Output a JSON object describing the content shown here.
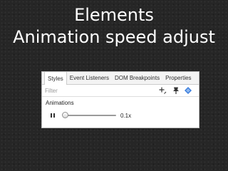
{
  "slide": {
    "title": "Elements",
    "subtitle": "Animation speed adjust"
  },
  "devtools": {
    "tabs": [
      {
        "label": "Styles",
        "active": true
      },
      {
        "label": "Event Listeners",
        "active": false
      },
      {
        "label": "DOM Breakpoints",
        "active": false
      },
      {
        "label": "Properties",
        "active": false
      }
    ],
    "filter": {
      "placeholder": "Filter",
      "value": ""
    },
    "toolbar_icons": [
      "add-style-rule-icon",
      "element-state-pin-icon",
      "color-format-icon"
    ],
    "animations": {
      "label": "Animations",
      "speed_value": "0.1x",
      "slider_fraction": 0.0,
      "paused": false,
      "pause_icon": "pause-icon"
    },
    "colors": {
      "accent_blue": "#3b7ddd",
      "slide_background": "#262626"
    }
  }
}
